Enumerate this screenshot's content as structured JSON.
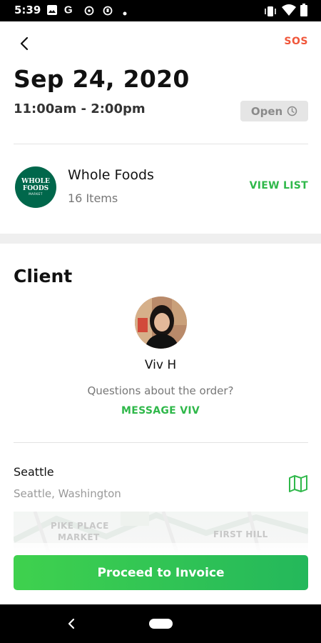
{
  "status_bar": {
    "time": "5:39",
    "left_icons": [
      "image-icon",
      "google-icon",
      "app-icon",
      "app-icon",
      "dot-icon"
    ],
    "right_icons": [
      "vibrate-icon",
      "wifi-icon",
      "battery-icon"
    ]
  },
  "header": {
    "sos_label": "SOS"
  },
  "order": {
    "date": "Sep 24, 2020",
    "time_range": "11:00am - 2:00pm",
    "status_label": "Open"
  },
  "store": {
    "logo_line1": "WHOLE",
    "logo_line2": "FOODS",
    "logo_line3": "MARKET",
    "name": "Whole Foods",
    "items": "16 Items",
    "view_list_label": "VIEW LIST"
  },
  "client": {
    "heading": "Client",
    "name": "Viv H",
    "question": "Questions about the order?",
    "message_label": "MESSAGE VIV"
  },
  "location": {
    "city": "Seattle",
    "region": "Seattle, Washington",
    "map_labels": [
      "PIKE PLACE",
      "MARKET",
      "FIRST HILL"
    ]
  },
  "actions": {
    "proceed_label": "Proceed to Invoice"
  },
  "colors": {
    "accent_green": "#2fb84a",
    "sos_red": "#f0563a",
    "button_gradient_start": "#3fd14e",
    "button_gradient_end": "#24b85b"
  }
}
